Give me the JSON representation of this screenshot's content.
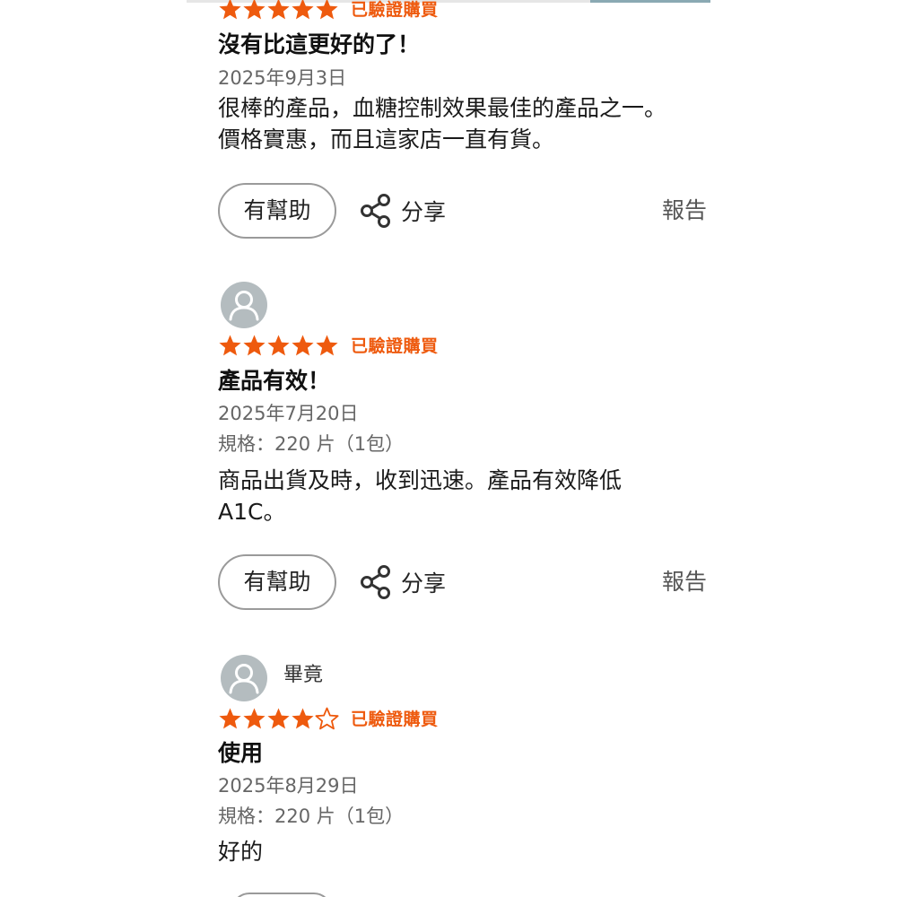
{
  "colors": {
    "star": "#ee5a0e",
    "verified": "#ee5a0e",
    "avatar": "#b4bcbf"
  },
  "labels": {
    "helpful": "有幫助",
    "share": "分享",
    "report": "報告",
    "verified": "已驗證購買"
  },
  "reviews": [
    {
      "rating": 5,
      "verified": "已驗證購買",
      "title": "沒有比這更好的了！",
      "date": "2025年9月3日",
      "body_lines": [
        "很棒的產品，血糖控制效果最佳的產品之一。",
        "價格實惠，而且這家店一直有貨。"
      ]
    },
    {
      "username": "",
      "rating": 5,
      "verified": "已驗證購買",
      "title": "產品有效！",
      "date": "2025年7月20日",
      "spec": "規格：220 片（1包）",
      "body_lines": [
        "商品出貨及時，收到迅速。產品有效降低",
        "A1C。"
      ]
    },
    {
      "username": "畢竟",
      "rating": 4,
      "verified": "已驗證購買",
      "title": "使用",
      "date": "2025年8月29日",
      "spec": "規格：220 片（1包）",
      "body_lines": [
        "好的"
      ]
    }
  ]
}
